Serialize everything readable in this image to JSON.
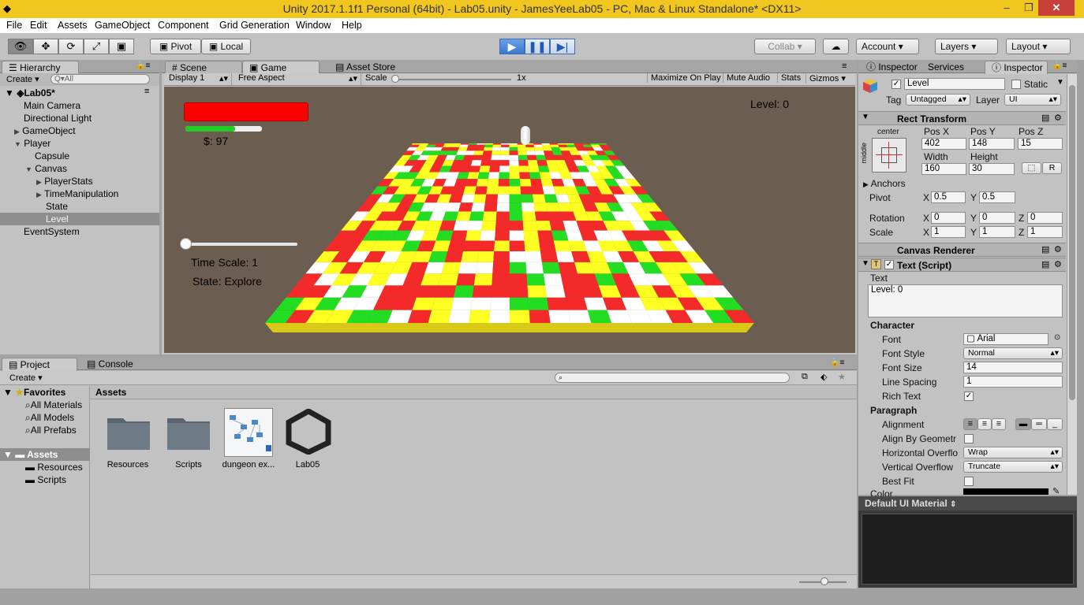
{
  "window": {
    "title": "Unity 2017.1.1f1 Personal (64bit) - Lab05.unity - JamesYeeLab05 - PC, Mac & Linux Standalone* <DX11>"
  },
  "menu": [
    "File",
    "Edit",
    "Assets",
    "GameObject",
    "Component",
    "Grid Generation",
    "Window",
    "Help"
  ],
  "toolbar": {
    "pivot": "Pivot",
    "local": "Local",
    "collab": "Collab ▾",
    "account": "Account",
    "layers": "Layers",
    "layout": "Layout"
  },
  "hierarchy": {
    "tab": "Hierarchy",
    "create": "Create ▾",
    "search_placeholder": "Q▾All",
    "scene": "Lab05*",
    "items": [
      "Main Camera",
      "Directional Light",
      "GameObject",
      "Player",
      "Capsule",
      "Canvas",
      "PlayerStats",
      "TimeManipulation",
      "State",
      "Level",
      "EventSystem"
    ]
  },
  "game": {
    "tabs": [
      "Scene",
      "Game",
      "Asset Store"
    ],
    "display": "Display 1",
    "aspect": "Free Aspect",
    "scale_label": "Scale",
    "scale_value": "1x",
    "buttons": [
      "Maximize On Play",
      "Mute Audio",
      "Stats",
      "Gizmos"
    ],
    "level": "Level: 0",
    "money": "$: 97",
    "time_scale": "Time Scale: 1",
    "state": "State: Explore",
    "health_fraction": 1.0,
    "stamina_fraction": 0.65,
    "slider_fraction": 0.0
  },
  "project": {
    "tabs": [
      "Project",
      "Console"
    ],
    "create": "Create ▾",
    "favorites_label": "Favorites",
    "favorites": [
      "All Materials",
      "All Models",
      "All Prefabs"
    ],
    "assets_label": "Assets",
    "assets_tree": [
      "Resources",
      "Scripts"
    ],
    "breadcrumb": "Assets",
    "items": [
      "Resources",
      "Scripts",
      "dungeon ex...",
      "Lab05"
    ]
  },
  "inspector": {
    "tabs": [
      "Inspector",
      "Services",
      "Inspector"
    ],
    "name": "Level",
    "static": "Static",
    "tag_label": "Tag",
    "tag": "Untagged",
    "layer_label": "Layer",
    "layer": "UI",
    "rect_transform": "Rect Transform",
    "anchor_h": "center",
    "anchor_v": "middle",
    "pos_labels": [
      "Pos X",
      "Pos Y",
      "Pos Z"
    ],
    "pos": [
      "402",
      "148",
      "15"
    ],
    "size_labels": [
      "Width",
      "Height"
    ],
    "size": [
      "160",
      "30"
    ],
    "r_btn": "R",
    "anchors": "Anchors",
    "pivot_label": "Pivot",
    "pivot": [
      "0.5",
      "0.5"
    ],
    "rotation_label": "Rotation",
    "rotation": [
      "0",
      "0",
      "0"
    ],
    "scale_label": "Scale",
    "scale": [
      "1",
      "1",
      "1"
    ],
    "axis": [
      "X",
      "Y",
      "Z"
    ],
    "canvas_renderer": "Canvas Renderer",
    "text_script": "Text (Script)",
    "text_label": "Text",
    "text_value": "Level: 0",
    "character": "Character",
    "font_label": "Font",
    "font": "Arial",
    "font_style_label": "Font Style",
    "font_style": "Normal",
    "font_size_label": "Font Size",
    "font_size": "14",
    "line_spacing_label": "Line Spacing",
    "line_spacing": "1",
    "rich_text_label": "Rich Text",
    "paragraph": "Paragraph",
    "alignment_label": "Alignment",
    "align_geom_label": "Align By Geometr",
    "h_overflow_label": "Horizontal Overflo",
    "h_overflow": "Wrap",
    "v_overflow_label": "Vertical Overflow",
    "v_overflow": "Truncate",
    "best_fit_label": "Best Fit",
    "color_label": "Color",
    "material": "Default UI Material"
  },
  "colors": {
    "title": "#f0c61f",
    "health": "#ff0000",
    "stamina": "#22cc22",
    "red": "#f42a2a",
    "yellow": "#ffff22",
    "green": "#22dd22",
    "white": "#ffffff"
  }
}
